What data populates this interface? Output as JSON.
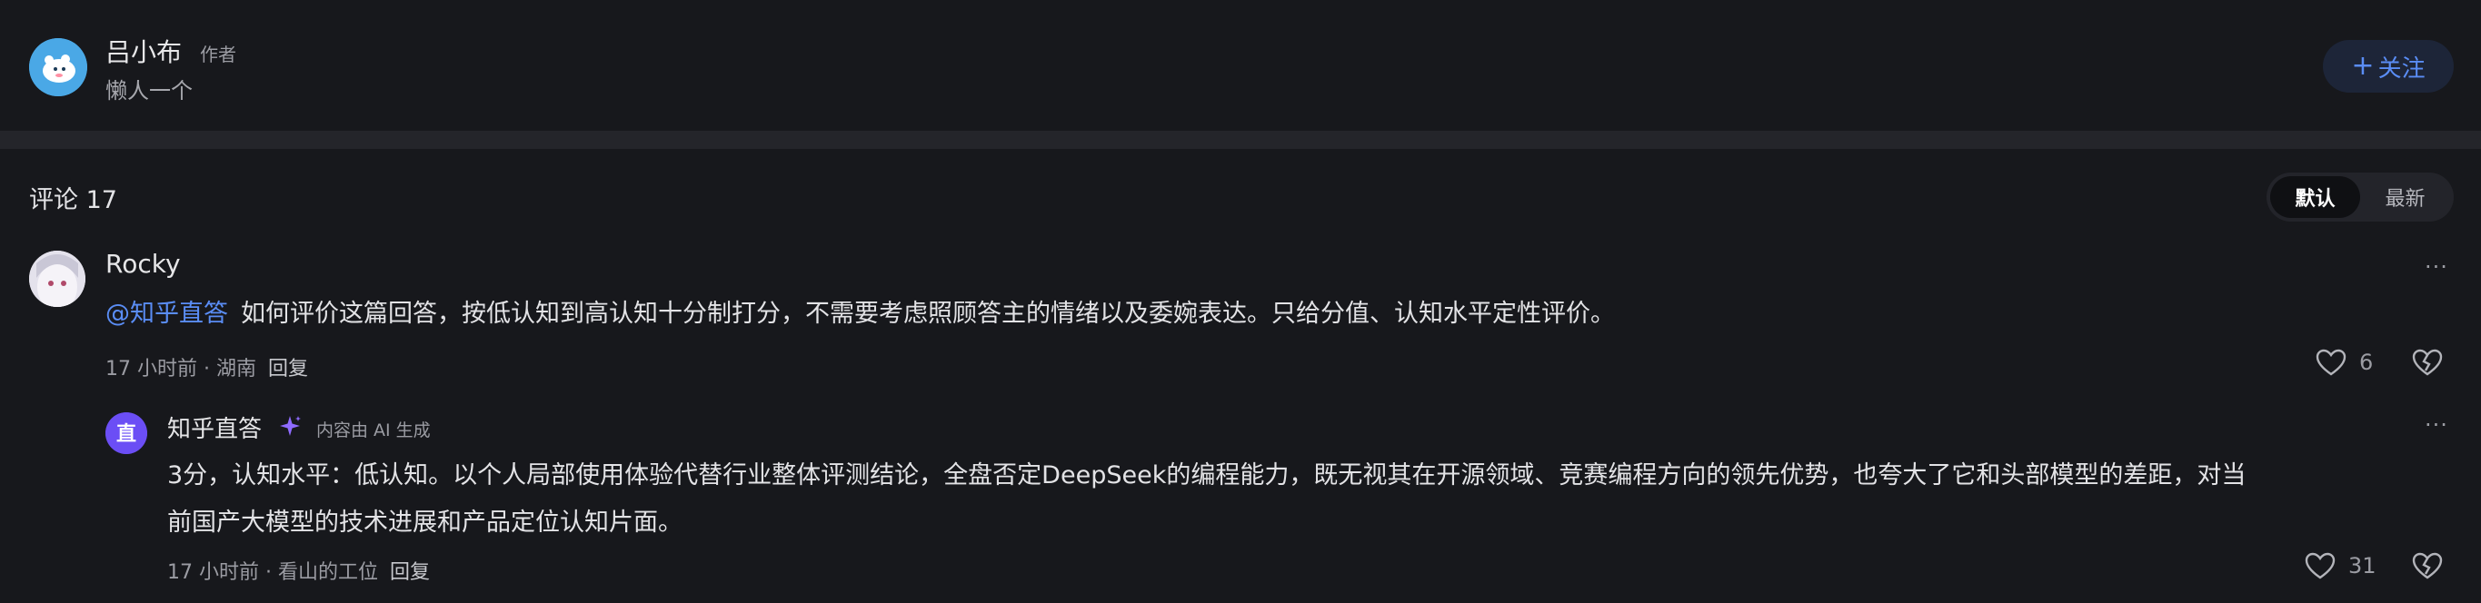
{
  "author": {
    "name": "吕小布",
    "tag": "作者",
    "bio": "懒人一个",
    "follow_label": "关注"
  },
  "comments": {
    "header": "评论 17",
    "sort": [
      "默认",
      "最新"
    ],
    "items": [
      {
        "name": "Rocky",
        "mention": "@知乎直答",
        "text": "如何评价这篇回答，按低认知到高认知十分制打分，不需要考虑照顾答主的情绪以及委婉表达。只给分值、认知水平定性评价。",
        "meta": "17 小时前 · 湖南",
        "reply_label": "回复",
        "likes": "6"
      },
      {
        "name": "知乎直答",
        "ai_label": "内容由 AI 生成",
        "text_line1": "3分，认知水平：低认知。以个人局部使用体验代替行业整体评测结论，全盘否定DeepSeek的编程能力，既无视其在开源领域、竞赛编程方向的领先优势，也夸大了它和头部模型的差距，对当",
        "text_line2": "前国产大模型的技术进展和产品定位认知片面。",
        "meta": "17 小时前 · 看山的工位",
        "reply_label": "回复",
        "likes": "31"
      }
    ]
  },
  "colors": {
    "accent": "#5a8df5",
    "background": "#17181c",
    "muted_text": "#9b9ca3"
  },
  "icons": {
    "more": "more-icon",
    "like": "heart-icon",
    "dislike": "broken-heart-icon",
    "ai": "sparkle-icon"
  }
}
